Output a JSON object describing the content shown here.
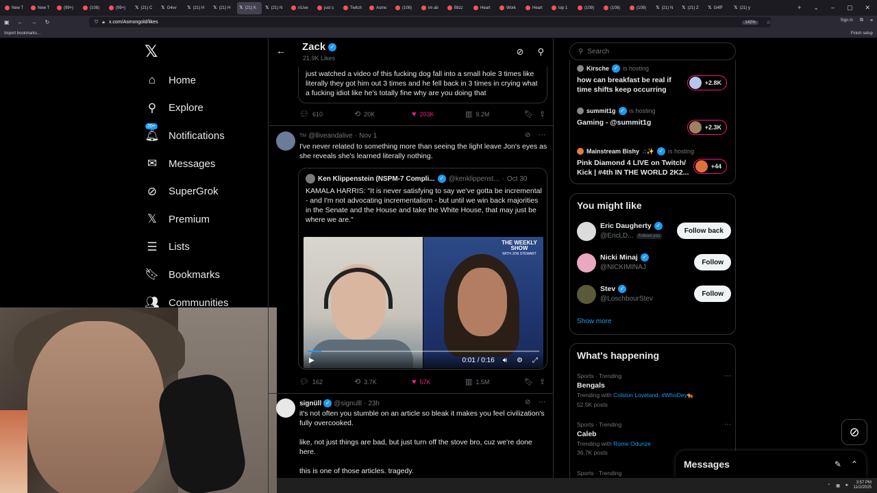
{
  "browser": {
    "tabs": [
      "New T",
      "New T",
      "(99+)",
      "(108)",
      "(99+)",
      "(21) C",
      "G4vv",
      "(21) H",
      "(21) H",
      "(21) K",
      "(21) N",
      "r/Live",
      "just s",
      "Twitch",
      "Asmo",
      "(108)",
      "im ab",
      "Blizz",
      "Heart",
      "Work",
      "Heart",
      "top 1",
      "(109)",
      "(108)",
      "(108)",
      "(21) N",
      "(21) Z",
      "G4fF",
      "(21) y"
    ],
    "active_tab_index": 9,
    "url": "x.com/Asmongold/likes",
    "zoom": "142%",
    "sign_in": "Sign in",
    "import_bookmarks": "Import bookmarks...",
    "finish_setup": "Finish setup"
  },
  "nav": {
    "items": [
      {
        "label": "Home",
        "icon": "home-icon"
      },
      {
        "label": "Explore",
        "icon": "search-icon"
      },
      {
        "label": "Notifications",
        "icon": "bell-icon",
        "badge": "20+"
      },
      {
        "label": "Messages",
        "icon": "mail-icon"
      },
      {
        "label": "SuperGrok",
        "icon": "grok-icon"
      },
      {
        "label": "Premium",
        "icon": "x-icon"
      },
      {
        "label": "Lists",
        "icon": "list-icon"
      },
      {
        "label": "Bookmarks",
        "icon": "bookmark-icon"
      },
      {
        "label": "Communities",
        "icon": "communities-icon"
      }
    ]
  },
  "header": {
    "name": "Zack",
    "likes": "21.9K Likes"
  },
  "tweet0": {
    "text": "just watched a video of this fucking dog fall into a small hole 3 times like literally they got him out 3 times and he fell back in 3 times in crying what a fucking idiot like he's totally fine why are you doing that",
    "replies": "610",
    "reposts": "20K",
    "likes": "203K",
    "views": "9.2M"
  },
  "tweet1": {
    "prefix": "TM",
    "handle": "@lliveandalive",
    "time": "Nov 1",
    "text": "I've never related to something more than seeing the light leave Jon's eyes as she reveals she's learned literally nothing.",
    "quote": {
      "name": "Ken Klippenstein (NSPM-7 Compli...",
      "handle": "@kenklippenst...",
      "time": "Oct 30",
      "text": "KAMALA HARRIS: \"It is never satisfying to say we've gotta be incremental - and I'm not advocating incrementalism - but until we win back majorities in the Senate and the House and take the White House, that may just be where we are.\"",
      "video_time": "0:01 / 0:16",
      "video_progress": 0.06,
      "show_title": "THE WEEKLY SHOW",
      "show_sub": "WITH JON STEWART"
    },
    "replies": "162",
    "reposts": "3.7K",
    "likes": "57K",
    "views": "1.5M"
  },
  "tweet2": {
    "name": "signüll",
    "handle": "@signulll",
    "time": "23h",
    "p1": "it's not often you stumble on an article so bleak it makes you feel civilization's fully overcooked.",
    "p2": "like, not just things are bad, but just turn off the stove bro, cuz we're done here.",
    "p3": "this is one of those articles. tragedy."
  },
  "search": {
    "placeholder": "Search"
  },
  "hosting": [
    {
      "name": "Kirsche",
      "status": "is hosting",
      "title": "how can breakfast be real if time shifts keep occurring",
      "count": "+2.8K"
    },
    {
      "name": "summit1g",
      "status": "is hosting",
      "title": "Gaming - @summit1g",
      "count": "+2.3K"
    },
    {
      "name": "Mainstream Bishy",
      "status": "is hosting",
      "title": "Pink Diamond 4 LIVE on Twitch/ Kick | #4th IN THE WORLD 2K2...",
      "count": "+44"
    }
  ],
  "you_might_like": {
    "title": "You might like",
    "people": [
      {
        "name": "Eric Daugherty",
        "handle": "@EricLD...",
        "follows_you": "Follows you",
        "button": "Follow back"
      },
      {
        "name": "Nicki Minaj",
        "handle": "@NICKIMINAJ",
        "follows_you": "",
        "button": "Follow"
      },
      {
        "name": "Stev",
        "handle": "@LoschbourStev",
        "follows_you": "",
        "button": "Follow"
      }
    ],
    "show_more": "Show more"
  },
  "whats_happening": {
    "title": "What's happening",
    "trends": [
      {
        "category": "Sports · Trending",
        "name": "Bengals",
        "with_label": "Trending with",
        "with": "Colston Loveland, #WhoDey🐅",
        "posts": "52.5K posts"
      },
      {
        "category": "Sports · Trending",
        "name": "Caleb",
        "with_label": "Trending with",
        "with": "Rome Odunze",
        "posts": "36.7K posts"
      },
      {
        "category": "Sports · Trending",
        "name": "",
        "with_label": "",
        "with": "",
        "posts": ""
      }
    ]
  },
  "messages_dock": {
    "title": "Messages"
  },
  "taskbar": {
    "time": "3:57 PM",
    "date": "11/2/2025"
  },
  "colors": {
    "accent": "#1d9bf0",
    "like": "#f91880",
    "bg": "#000000",
    "border": "#2f3336"
  }
}
